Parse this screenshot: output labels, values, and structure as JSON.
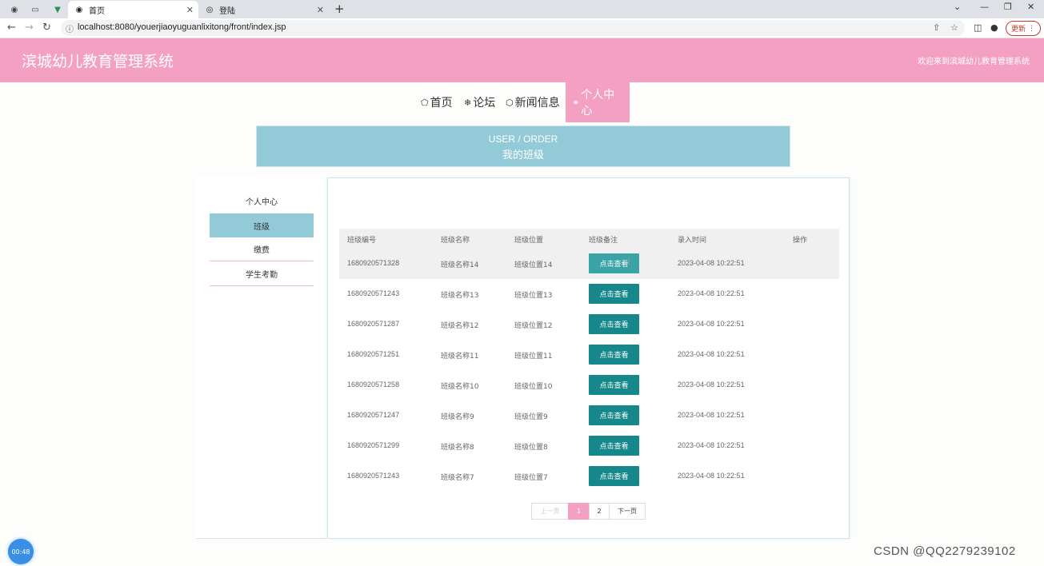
{
  "browser": {
    "tabs": [
      {
        "title": "首页",
        "icon": "globe-icon"
      },
      {
        "title": "登陆",
        "icon": "location-icon"
      }
    ],
    "url": "localhost:8080/youerjiaoyuguanlixitong/front/index.jsp",
    "update_label": "更新"
  },
  "header": {
    "title": "滨城幼儿教育管理系统",
    "welcome": "欢迎来到滨城幼儿教育管理系统"
  },
  "nav": {
    "items": [
      {
        "label": "首页",
        "icon": "home-icon"
      },
      {
        "label": "论坛",
        "icon": "snowflake-icon"
      },
      {
        "label": "新闻信息",
        "icon": "cube-icon"
      },
      {
        "label": "个人中心",
        "icon": "user-icon",
        "active": true
      }
    ]
  },
  "banner": {
    "en": "USER / ORDER",
    "cn": "我的班级"
  },
  "sidebar": {
    "items": [
      {
        "label": "个人中心"
      },
      {
        "label": "班级",
        "active": true
      },
      {
        "label": "缴费"
      },
      {
        "label": "学生考勤"
      }
    ]
  },
  "table": {
    "columns": [
      "班级编号",
      "班级名称",
      "班级位置",
      "班级备注",
      "录入时间",
      "操作"
    ],
    "button_label": "点击查看",
    "rows": [
      {
        "id": "1680920571328",
        "name": "班级名称14",
        "location": "班级位置14",
        "time": "2023-04-08 10:22:51"
      },
      {
        "id": "1680920571243",
        "name": "班级名称13",
        "location": "班级位置13",
        "time": "2023-04-08 10:22:51"
      },
      {
        "id": "1680920571287",
        "name": "班级名称12",
        "location": "班级位置12",
        "time": "2023-04-08 10:22:51"
      },
      {
        "id": "1680920571251",
        "name": "班级名称11",
        "location": "班级位置11",
        "time": "2023-04-08 10:22:51"
      },
      {
        "id": "1680920571258",
        "name": "班级名称10",
        "location": "班级位置10",
        "time": "2023-04-08 10:22:51"
      },
      {
        "id": "1680920571247",
        "name": "班级名称9",
        "location": "班级位置9",
        "time": "2023-04-08 10:22:51"
      },
      {
        "id": "1680920571299",
        "name": "班级名称8",
        "location": "班级位置8",
        "time": "2023-04-08 10:22:51"
      },
      {
        "id": "1680920571243",
        "name": "班级名称7",
        "location": "班级位置7",
        "time": "2023-04-08 10:22:51"
      }
    ]
  },
  "pagination": {
    "prev": "上一页",
    "pages": [
      "1",
      "2"
    ],
    "current": "1",
    "next": "下一页"
  },
  "timer": "00:48",
  "watermark": "CSDN @QQ2279239102",
  "colors": {
    "accent_pink": "#f4a0c2",
    "banner_blue": "#93cad7",
    "button_teal": "#16878a"
  }
}
